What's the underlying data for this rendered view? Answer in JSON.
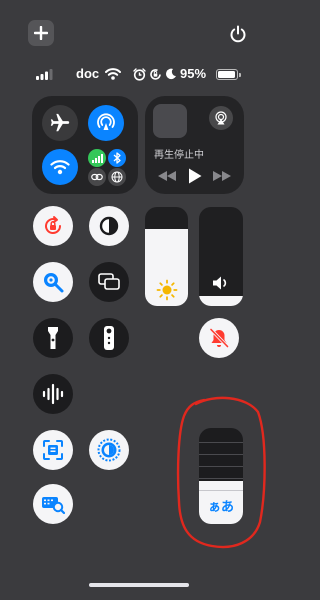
{
  "status_bar": {
    "carrier": "doc",
    "battery_percent": "95%",
    "battery_level": 0.95,
    "signal_bars": 3
  },
  "media": {
    "status_label": "再生停止中"
  },
  "sliders": {
    "brightness_level": 0.78,
    "volume_level": 0.1
  },
  "text_size": {
    "label": "ぁあ",
    "level": 0.45
  },
  "colors": {
    "accent_blue": "#0a84ff",
    "accent_red": "#ff3b30",
    "annotation_red": "#e0281e",
    "sun_yellow": "#f5b700",
    "connectivity_green": "#34c759"
  },
  "icons": {
    "add": "plus-icon",
    "power": "power-icon",
    "airplane": "airplane-icon",
    "airdrop": "airdrop-icon",
    "wifi": "wifi-icon",
    "cellular": "cellular-icon",
    "bluetooth": "bluetooth-icon",
    "airplay": "airplay-icon"
  }
}
